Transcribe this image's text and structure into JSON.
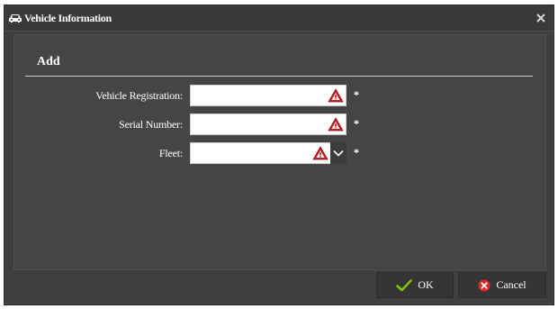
{
  "window": {
    "title": "Vehicle Information",
    "title_icon": "car-icon",
    "close_icon": "close-icon"
  },
  "section": {
    "title": "Add"
  },
  "form": {
    "fields": [
      {
        "label": "Vehicle Registration:",
        "value": "",
        "required_marker": "*",
        "status_icon": "warning-icon"
      },
      {
        "label": "Serial Number:",
        "value": "",
        "required_marker": "*",
        "status_icon": "warning-icon"
      },
      {
        "label": "Fleet:",
        "value": "",
        "required_marker": "*",
        "status_icon": "warning-icon",
        "control": "dropdown"
      }
    ]
  },
  "buttons": {
    "ok_label": "OK",
    "ok_icon": "checkmark-icon",
    "cancel_label": "Cancel",
    "cancel_icon": "cancel-icon"
  },
  "colors": {
    "dialog_bg": "#3f3f3f",
    "panel_bg": "#454545",
    "warning": "#cc1f1f",
    "ok_check": "#7ec400",
    "cancel_red": "#e02a2a"
  }
}
